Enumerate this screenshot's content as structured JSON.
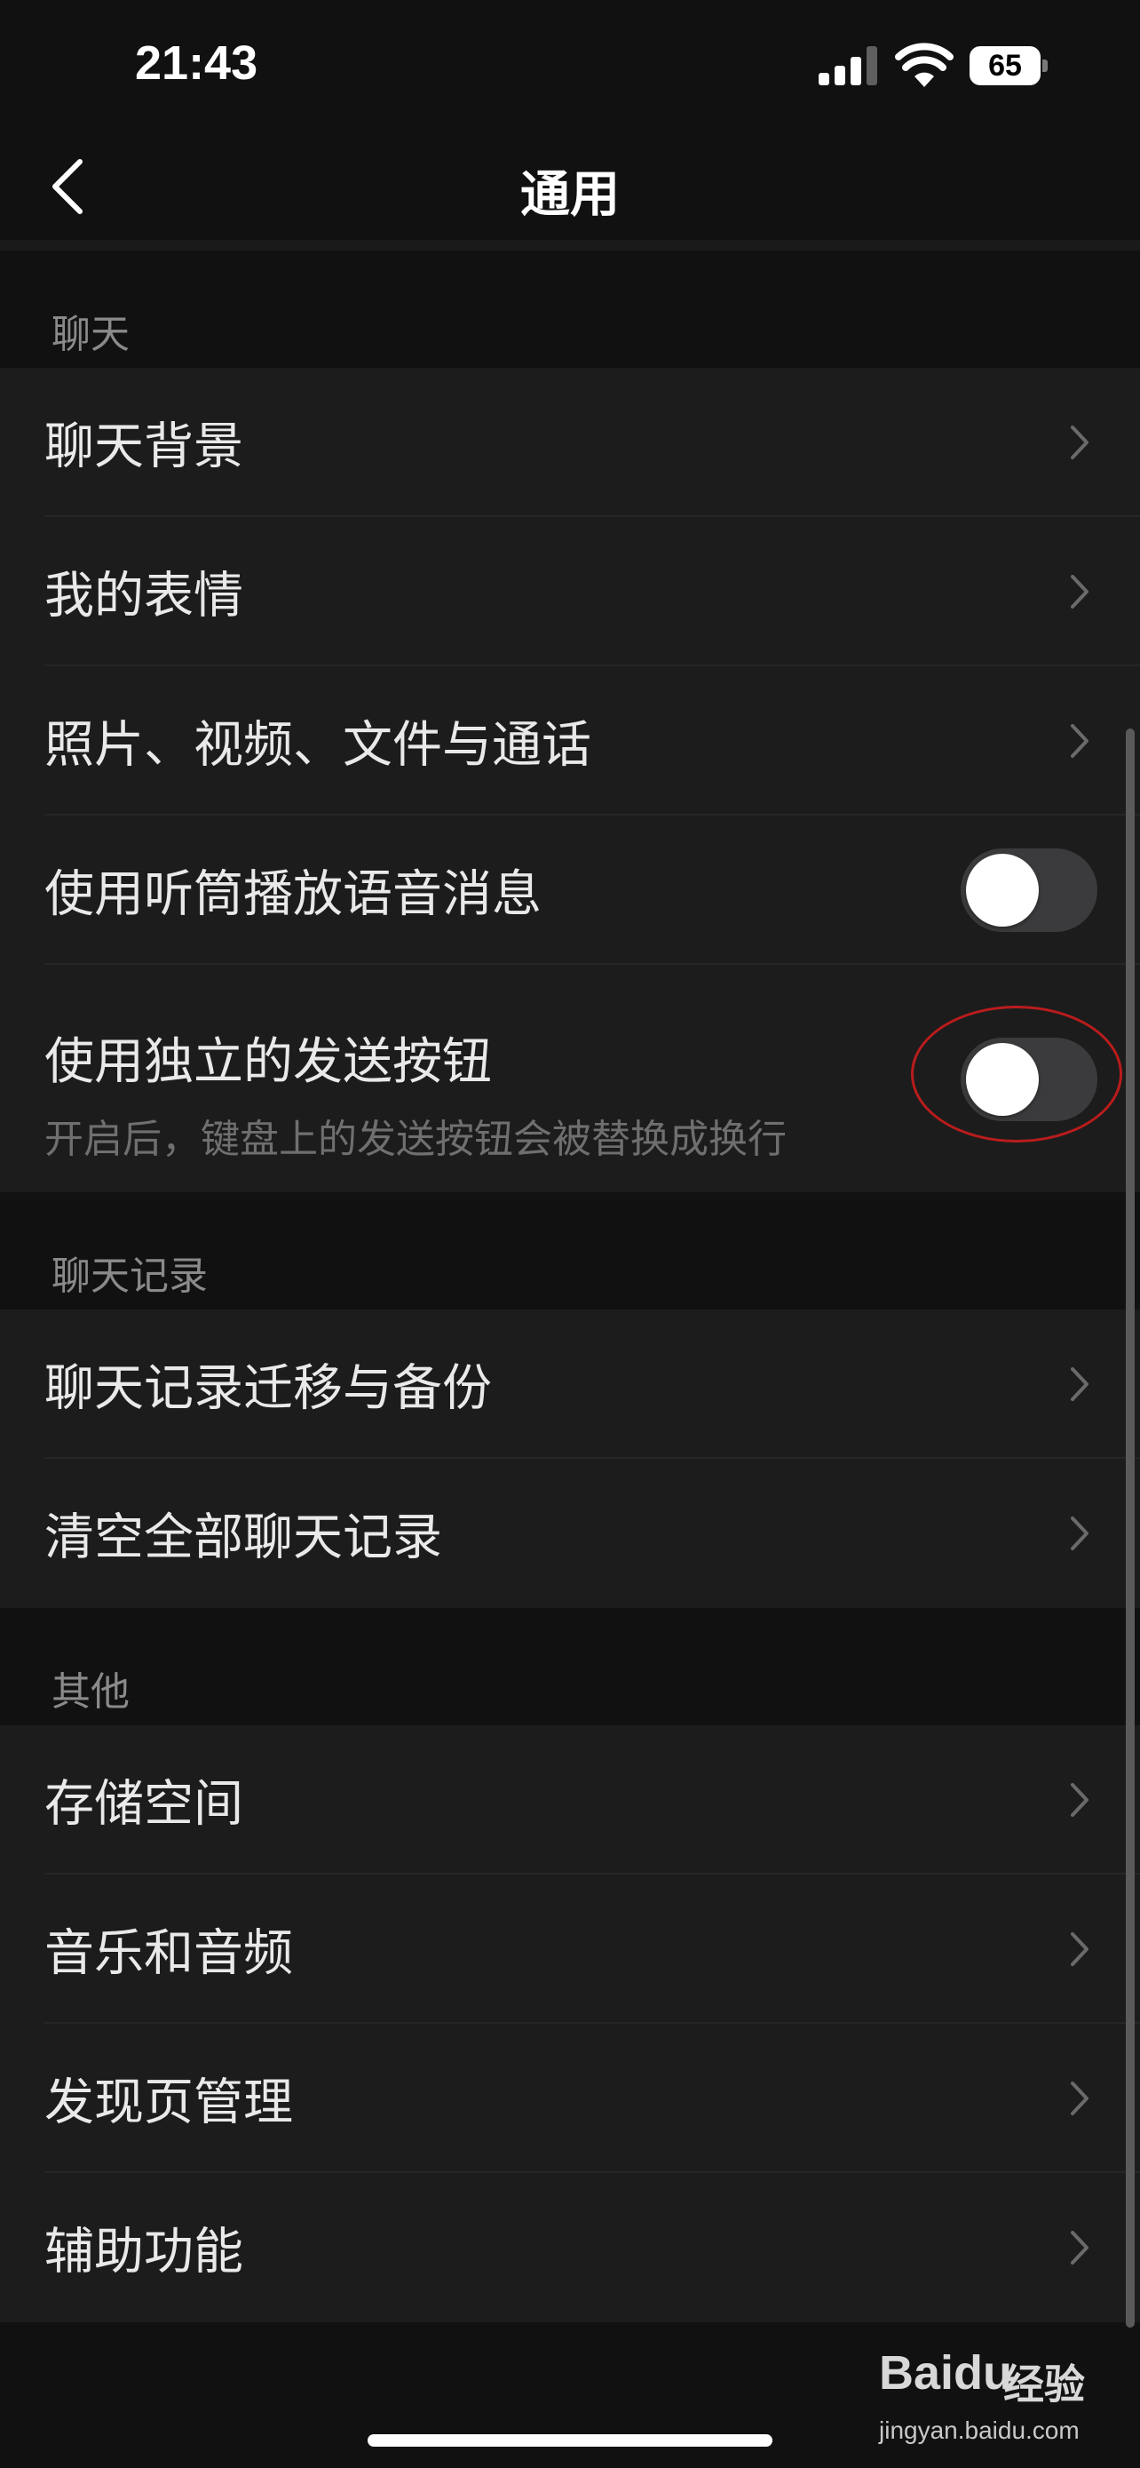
{
  "status_bar": {
    "time": "21:43",
    "battery": "65"
  },
  "nav": {
    "title": "通用"
  },
  "sections": {
    "chat": {
      "header": "聊天",
      "items": {
        "background": "聊天背景",
        "stickers": "我的表情",
        "media": "照片、视频、文件与通话",
        "earpiece": "使用听筒播放语音消息",
        "send_button": "使用独立的发送按钮",
        "send_button_desc": "开启后，键盘上的发送按钮会被替换成换行"
      },
      "toggles": {
        "earpiece_on": false,
        "send_button_on": false
      }
    },
    "history": {
      "header": "聊天记录",
      "items": {
        "migrate": "聊天记录迁移与备份",
        "clear": "清空全部聊天记录"
      }
    },
    "other": {
      "header": "其他",
      "items": {
        "storage": "存储空间",
        "music": "音乐和音频",
        "discover": "发现页管理",
        "accessibility": "辅助功能"
      }
    }
  },
  "watermark": {
    "logo": "Baidu",
    "cn": "经验",
    "url": "jingyan.baidu.com"
  },
  "colors": {
    "background": "#111111",
    "cell": "#1c1c1c",
    "highlight": "#b91c1c",
    "toggle_off": "#3b3b3d"
  }
}
